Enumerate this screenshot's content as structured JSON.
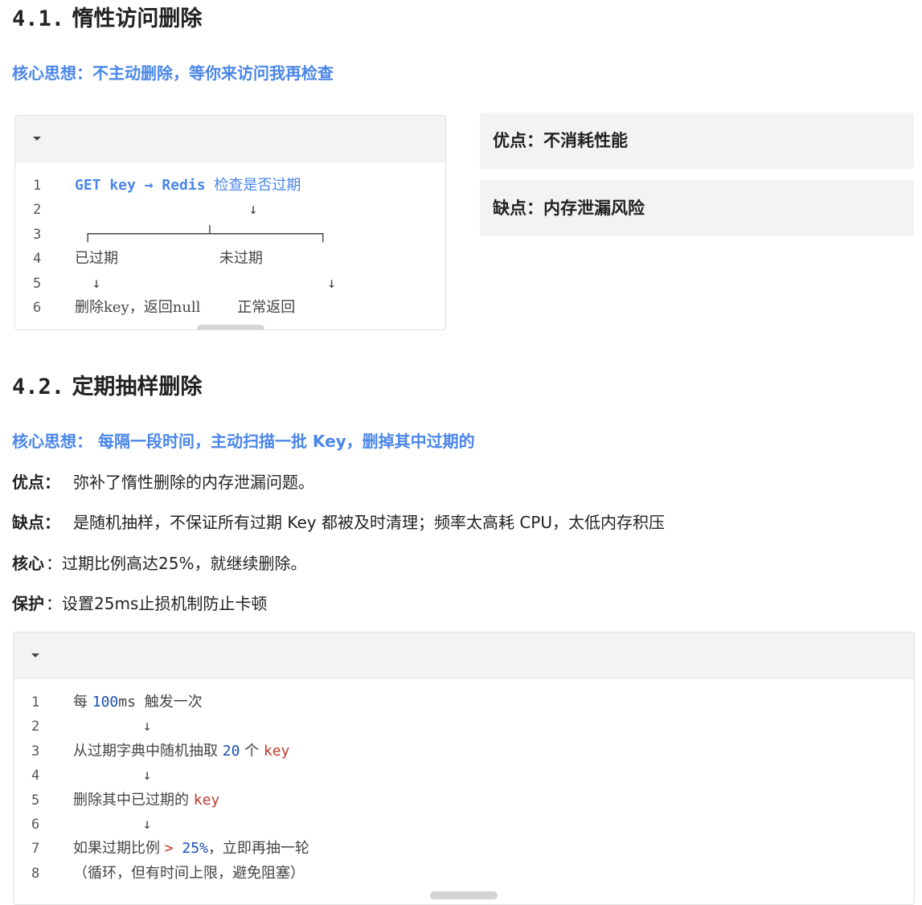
{
  "section1": {
    "num": "4.1.",
    "title": "惰性访问删除",
    "core": "核心思想：不主动删除，等你来访问我再检查",
    "code": [
      {
        "n": "1",
        "parts": [
          {
            "t": "GET key → Redis ",
            "c": "kw"
          },
          {
            "t": "检查是否过期",
            "c": "kwcn"
          }
        ]
      },
      {
        "n": "2",
        "parts": [
          {
            "t": "                    ↓",
            "c": ""
          }
        ]
      },
      {
        "n": "3",
        "parts": [
          {
            "t": " ┌─────────────┴────────────┐",
            "c": ""
          }
        ]
      },
      {
        "n": "4",
        "parts": [
          {
            "t": "已过期                      未过期",
            "c": "cn"
          }
        ]
      },
      {
        "n": "5",
        "parts": [
          {
            "t": "  ↓                          ↓",
            "c": ""
          }
        ]
      },
      {
        "n": "6",
        "parts": [
          {
            "t": "删除key，返回null        正常返回",
            "c": "cn"
          }
        ]
      }
    ],
    "pros": "优点：不消耗性能",
    "cons": "缺点：内存泄漏风险"
  },
  "section2": {
    "num": "4.2.",
    "title": "定期抽样删除",
    "core": "核心思想： 每隔一段时间，主动扫描一批 Key，删掉其中过期的",
    "pros_label": "优点：",
    "pros_text": "弥补了惰性删除的内存泄漏问题。",
    "cons_label": "缺点：",
    "cons_text": "是随机抽样，不保证所有过期 Key 都被及时清理；频率太高耗 CPU，太低内存积压",
    "core2_label": "核心",
    "core2_text": "：过期比例高达25%，就继续删除。",
    "protect_label": "保护",
    "protect_text": "：设置25ms止损机制防止卡顿",
    "code": [
      {
        "n": "1",
        "parts": [
          {
            "t": "每 ",
            "c": "cn"
          },
          {
            "t": "100",
            "c": "num2"
          },
          {
            "t": "ms ",
            "c": ""
          },
          {
            "t": "触发一次",
            "c": "cn"
          }
        ]
      },
      {
        "n": "2",
        "parts": [
          {
            "t": "        ↓",
            "c": ""
          }
        ]
      },
      {
        "n": "3",
        "parts": [
          {
            "t": "从过期字典中随机抽取 ",
            "c": "cn"
          },
          {
            "t": "20",
            "c": "num2"
          },
          {
            "t": " 个 ",
            "c": "cn"
          },
          {
            "t": "key",
            "c": "red"
          }
        ]
      },
      {
        "n": "4",
        "parts": [
          {
            "t": "        ↓",
            "c": ""
          }
        ]
      },
      {
        "n": "5",
        "parts": [
          {
            "t": "删除其中已过期的 ",
            "c": "cn"
          },
          {
            "t": "key",
            "c": "red"
          }
        ]
      },
      {
        "n": "6",
        "parts": [
          {
            "t": "        ↓",
            "c": ""
          }
        ]
      },
      {
        "n": "7",
        "parts": [
          {
            "t": "如果过期比例 ",
            "c": "cn"
          },
          {
            "t": "> ",
            "c": "red"
          },
          {
            "t": "25%",
            "c": "num2"
          },
          {
            "t": "，立即再抽一轮",
            "c": "cn"
          }
        ]
      },
      {
        "n": "8",
        "parts": [
          {
            "t": "（循环，但有时间上限，避免阻塞）",
            "c": "cn"
          }
        ]
      }
    ]
  }
}
